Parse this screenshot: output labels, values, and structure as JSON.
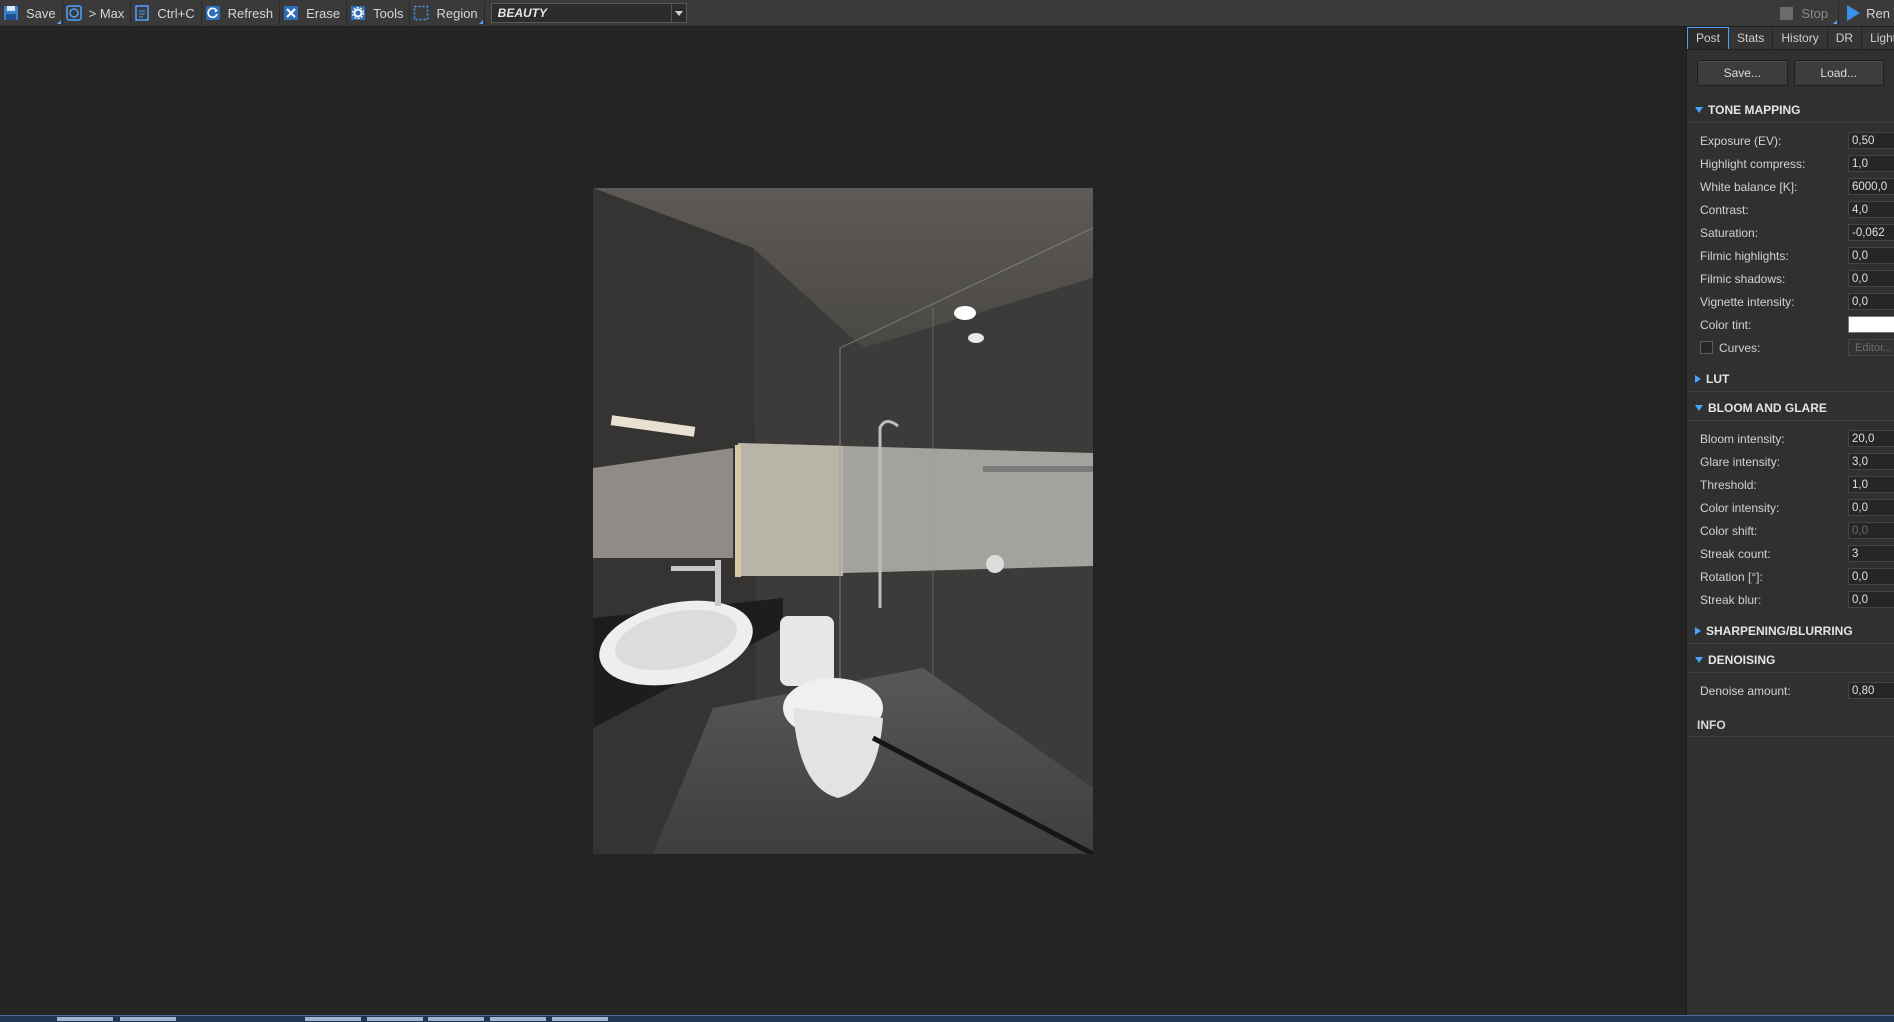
{
  "toolbar": {
    "save": "Save",
    "max": "> Max",
    "copy": "Ctrl+C",
    "refresh": "Refresh",
    "erase": "Erase",
    "tools": "Tools",
    "region": "Region",
    "channel": "BEAUTY",
    "stop": "Stop",
    "render": "Ren"
  },
  "tabs": [
    "Post",
    "Stats",
    "History",
    "DR",
    "LightI"
  ],
  "panel": {
    "save_btn": "Save...",
    "load_btn": "Load...",
    "tone_mapping": {
      "title": "TONE MAPPING",
      "exposure_label": "Exposure (EV):",
      "exposure": "0,50",
      "highlight_label": "Highlight compress:",
      "highlight": "1,0",
      "wb_label": "White balance [K]:",
      "wb": "6000,0",
      "contrast_label": "Contrast:",
      "contrast": "4,0",
      "saturation_label": "Saturation:",
      "saturation": "-0,062",
      "filmic_hl_label": "Filmic highlights:",
      "filmic_hl": "0,0",
      "filmic_sh_label": "Filmic shadows:",
      "filmic_sh": "0,0",
      "vignette_label": "Vignette intensity:",
      "vignette": "0,0",
      "tint_label": "Color tint:",
      "tint_color": "#ffffff",
      "curves_label": "Curves:",
      "editor_btn": "Editor..."
    },
    "lut": {
      "title": "LUT"
    },
    "bloom": {
      "title": "BLOOM AND GLARE",
      "bloom_label": "Bloom intensity:",
      "bloom": "20,0",
      "glare_label": "Glare intensity:",
      "glare": "3,0",
      "threshold_label": "Threshold:",
      "threshold": "1,0",
      "color_int_label": "Color intensity:",
      "color_int": "0,0",
      "color_shift_label": "Color shift:",
      "color_shift": "0,0",
      "streak_count_label": "Streak count:",
      "streak_count": "3",
      "rotation_label": "Rotation [°]:",
      "rotation": "0,0",
      "streak_blur_label": "Streak blur:",
      "streak_blur": "0,0"
    },
    "sharpening": {
      "title": "SHARPENING/BLURRING"
    },
    "denoising": {
      "title": "DENOISING",
      "amount_label": "Denoise amount:",
      "amount": "0,80"
    },
    "info": {
      "title": "INFO"
    }
  },
  "colors": {
    "accent": "#4aa3ff",
    "render_arrow": "#3a8fe8"
  }
}
